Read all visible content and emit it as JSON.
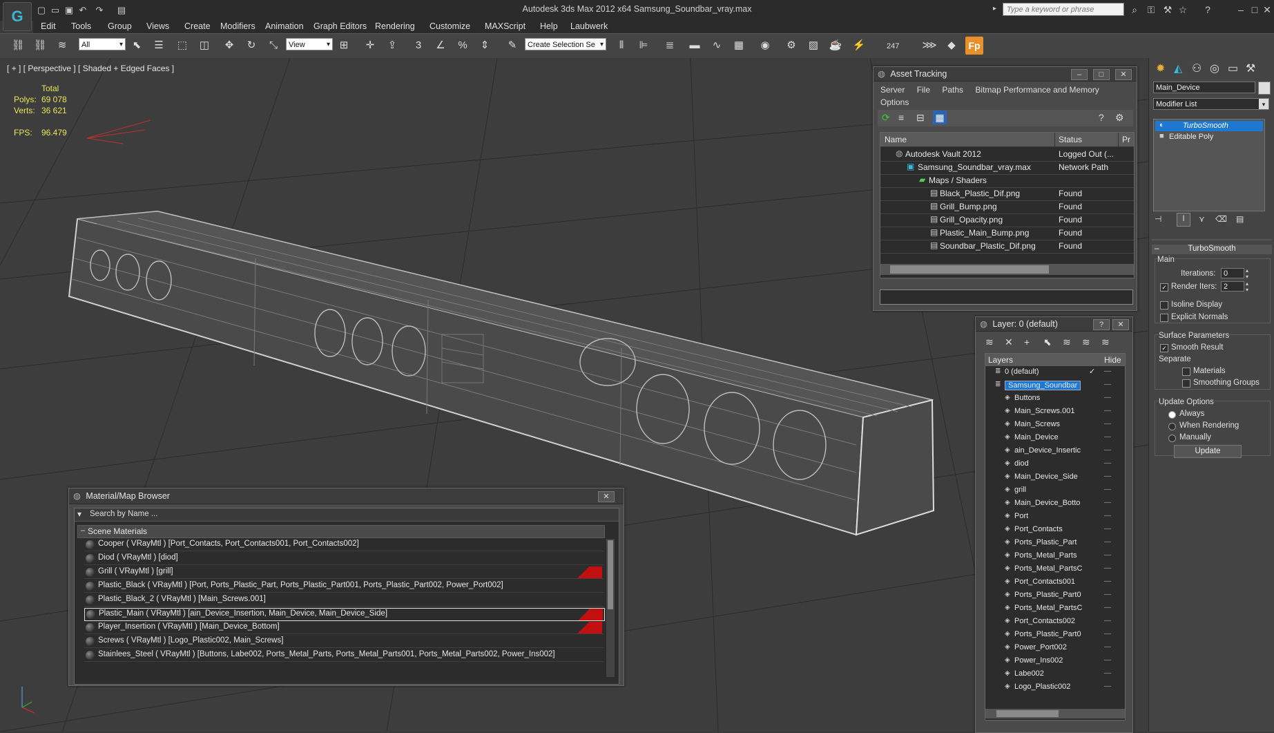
{
  "app": {
    "title": "Autodesk 3ds Max  2012 x64      Samsung_Soundbar_vray.max",
    "search_placeholder": "Type a keyword or phrase"
  },
  "menu": [
    "Edit",
    "Tools",
    "Group",
    "Views",
    "Create",
    "Modifiers",
    "Animation",
    "Graph Editors",
    "Rendering",
    "Customize",
    "MAXScript",
    "Help",
    "Laubwerk"
  ],
  "toolbar": {
    "selection_filter": "All",
    "ref_coord": "View",
    "named_selection": "Create Selection Se",
    "counter": "247",
    "fp_label": "Fp"
  },
  "viewport": {
    "label": "[ + ] [ Perspective ] [ Shaded + Edged Faces ]",
    "stats": {
      "total_label": "Total",
      "polys_label": "Polys:",
      "polys": "69 078",
      "verts_label": "Verts:",
      "verts": "36 621",
      "fps_label": "FPS:",
      "fps": "96.479"
    }
  },
  "asset_tracking": {
    "title": "Asset Tracking",
    "menu": [
      "Server",
      "File",
      "Paths",
      "Bitmap Performance and Memory",
      "Options"
    ],
    "col_name": "Name",
    "col_status": "Status",
    "col_extra": "Pr",
    "rows": [
      {
        "name": "Autodesk Vault 2012",
        "status": "Logged Out (..."
      },
      {
        "name": "Samsung_Soundbar_vray.max",
        "status": "Network Path"
      },
      {
        "name": "Maps / Shaders",
        "status": ""
      },
      {
        "name": "Black_Plastic_Dif.png",
        "status": "Found"
      },
      {
        "name": "Grill_Bump.png",
        "status": "Found"
      },
      {
        "name": "Grill_Opacity.png",
        "status": "Found"
      },
      {
        "name": "Plastic_Main_Bump.png",
        "status": "Found"
      },
      {
        "name": "Soundbar_Plastic_Dif.png",
        "status": "Found"
      }
    ]
  },
  "layer_window": {
    "title": "Layer: 0 (default)",
    "col_layers": "Layers",
    "col_hide": "Hide",
    "layers": [
      "0 (default)",
      "Samsung_Soundbar",
      "Buttons",
      "Main_Screws.001",
      "Main_Screws",
      "Main_Device",
      "ain_Device_Insertic",
      "diod",
      "Main_Device_Side",
      "grill",
      "Main_Device_Botto",
      "Port",
      "Port_Contacts",
      "Ports_Plastic_Part",
      "Ports_Metal_Parts",
      "Ports_Metal_PartsC",
      "Port_Contacts001",
      "Ports_Plastic_Part0",
      "Ports_Metal_PartsC",
      "Port_Contacts002",
      "Ports_Plastic_Part0",
      "Power_Port002",
      "Power_Ins002",
      "Labe002",
      "Logo_Plastic002"
    ]
  },
  "material_browser": {
    "title": "Material/Map Browser",
    "search_placeholder": "Search by Name ...",
    "section": "Scene Materials",
    "materials": [
      {
        "text": "Cooper  ( VRayMtl )  [Port_Contacts, Port_Contacts001, Port_Contacts002]",
        "red": false
      },
      {
        "text": "Diod  ( VRayMtl )  [diod]",
        "red": false
      },
      {
        "text": "Grill  ( VRayMtl )  [grill]",
        "red": true
      },
      {
        "text": "Plastic_Black  ( VRayMtl )  [Port, Ports_Plastic_Part, Ports_Plastic_Part001, Ports_Plastic_Part002, Power_Port002]",
        "red": false
      },
      {
        "text": "Plastic_Black_2  ( VRayMtl )  [Main_Screws.001]",
        "red": false
      },
      {
        "text": "Plastic_Main  ( VRayMtl )  [ain_Device_Insertion, Main_Device, Main_Device_Side]",
        "red": true
      },
      {
        "text": "Player_Insertion  ( VRayMtl )  [Main_Device_Bottom]",
        "red": true
      },
      {
        "text": "Screws  ( VRayMtl )  [Logo_Plastic002, Main_Screws]",
        "red": false
      },
      {
        "text": "Stainlees_Steel  ( VRayMtl )  [Buttons, Labe002, Ports_Metal_Parts, Ports_Metal_Parts001, Ports_Metal_Parts002, Power_Ins002]",
        "red": false
      }
    ]
  },
  "command_panel": {
    "object_name": "Main_Device",
    "modifier_list": "Modifier List",
    "stack": [
      "TurboSmooth",
      "Editable Poly"
    ],
    "rollout_title": "TurboSmooth",
    "main_label": "Main",
    "iterations_label": "Iterations:",
    "iterations": "0",
    "render_iters_label": "Render Iters:",
    "render_iters": "2",
    "isoline": "Isoline Display",
    "explicit_normals": "Explicit Normals",
    "surface_params": "Surface Parameters",
    "smooth_result": "Smooth Result",
    "separate": "Separate",
    "materials": "Materials",
    "smoothing_groups": "Smoothing Groups",
    "update_options": "Update Options",
    "always": "Always",
    "when_rendering": "When Rendering",
    "manually": "Manually",
    "update_button": "Update"
  },
  "colors": {
    "bg": "#3a3a3a",
    "viewport": "#3d3d3d",
    "selection": "#1e78d2",
    "stats": "#e8e85a",
    "accent": "#39b6d8",
    "warn": "#c21010"
  }
}
